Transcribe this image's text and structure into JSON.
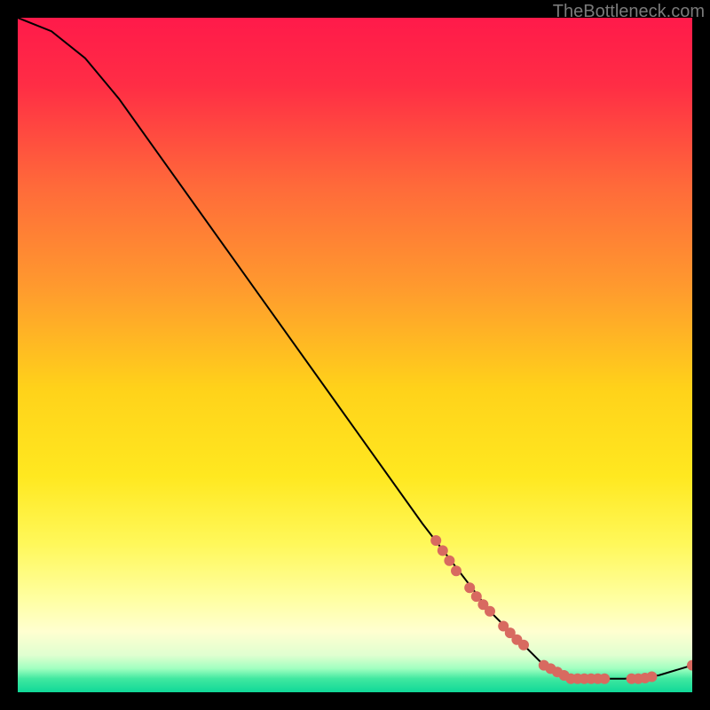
{
  "attribution": "TheBottleneck.com",
  "chart_data": {
    "type": "line",
    "title": "",
    "xlabel": "",
    "ylabel": "",
    "xlim": [
      0,
      100
    ],
    "ylim": [
      0,
      100
    ],
    "curve": [
      {
        "x": 0,
        "y": 100
      },
      {
        "x": 5,
        "y": 98
      },
      {
        "x": 10,
        "y": 94
      },
      {
        "x": 15,
        "y": 88
      },
      {
        "x": 20,
        "y": 81
      },
      {
        "x": 30,
        "y": 67
      },
      {
        "x": 40,
        "y": 53
      },
      {
        "x": 50,
        "y": 39
      },
      {
        "x": 60,
        "y": 25
      },
      {
        "x": 70,
        "y": 12
      },
      {
        "x": 78,
        "y": 4
      },
      {
        "x": 82,
        "y": 2
      },
      {
        "x": 90,
        "y": 2
      },
      {
        "x": 95,
        "y": 2.5
      },
      {
        "x": 100,
        "y": 4
      }
    ],
    "markers": [
      {
        "x": 62,
        "y": 22.5
      },
      {
        "x": 63,
        "y": 21
      },
      {
        "x": 64,
        "y": 19.5
      },
      {
        "x": 65,
        "y": 18
      },
      {
        "x": 67,
        "y": 15.5
      },
      {
        "x": 68,
        "y": 14.2
      },
      {
        "x": 69,
        "y": 13
      },
      {
        "x": 70,
        "y": 12
      },
      {
        "x": 72,
        "y": 9.8
      },
      {
        "x": 73,
        "y": 8.8
      },
      {
        "x": 74,
        "y": 7.8
      },
      {
        "x": 75,
        "y": 7
      },
      {
        "x": 78,
        "y": 4
      },
      {
        "x": 79,
        "y": 3.5
      },
      {
        "x": 80,
        "y": 3
      },
      {
        "x": 81,
        "y": 2.5
      },
      {
        "x": 82,
        "y": 2
      },
      {
        "x": 83,
        "y": 2
      },
      {
        "x": 84,
        "y": 2
      },
      {
        "x": 85,
        "y": 2
      },
      {
        "x": 86,
        "y": 2
      },
      {
        "x": 87,
        "y": 2
      },
      {
        "x": 91,
        "y": 2
      },
      {
        "x": 92,
        "y": 2
      },
      {
        "x": 93,
        "y": 2.1
      },
      {
        "x": 94,
        "y": 2.3
      },
      {
        "x": 100,
        "y": 4
      }
    ],
    "marker_color": "#d86a60",
    "curve_color": "#000000",
    "background_gradient": {
      "stops": [
        {
          "offset": 0.0,
          "color": "#ff1a4a"
        },
        {
          "offset": 0.1,
          "color": "#ff2d45"
        },
        {
          "offset": 0.25,
          "color": "#ff6a3a"
        },
        {
          "offset": 0.4,
          "color": "#ff9a2e"
        },
        {
          "offset": 0.55,
          "color": "#ffd21a"
        },
        {
          "offset": 0.68,
          "color": "#ffe820"
        },
        {
          "offset": 0.78,
          "color": "#fff85a"
        },
        {
          "offset": 0.86,
          "color": "#ffffa0"
        },
        {
          "offset": 0.91,
          "color": "#ffffd0"
        },
        {
          "offset": 0.945,
          "color": "#e0ffd0"
        },
        {
          "offset": 0.965,
          "color": "#a0ffc0"
        },
        {
          "offset": 0.98,
          "color": "#40e8a0"
        },
        {
          "offset": 1.0,
          "color": "#10d898"
        }
      ]
    }
  }
}
